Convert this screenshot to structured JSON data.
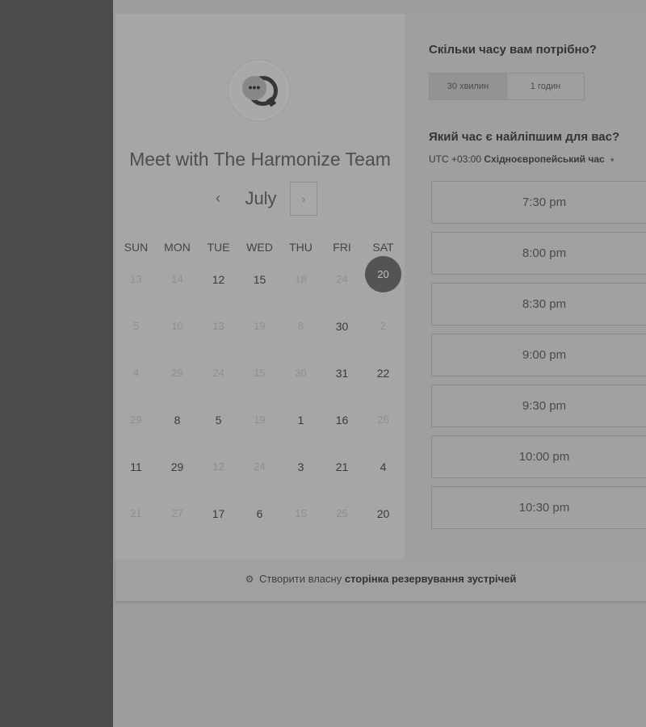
{
  "header": {
    "team_title": "Meet with The Harmonize Team"
  },
  "calendar": {
    "month": "July",
    "prev_icon": "‹",
    "next_icon": "›",
    "weekdays": [
      "SUN",
      "MON",
      "TUE",
      "WED",
      "THU",
      "FRI",
      "SAT"
    ],
    "weeks": [
      [
        {
          "d": "13",
          "s": "muted"
        },
        {
          "d": "14",
          "s": "muted"
        },
        {
          "d": "12",
          "s": "active"
        },
        {
          "d": "15",
          "s": "active"
        },
        {
          "d": "18",
          "s": "muted"
        },
        {
          "d": "24",
          "s": "muted"
        },
        {
          "d": "20",
          "s": "selected"
        }
      ],
      [
        {
          "d": "5",
          "s": "muted"
        },
        {
          "d": "10",
          "s": "muted"
        },
        {
          "d": "13",
          "s": "muted"
        },
        {
          "d": "19",
          "s": "muted"
        },
        {
          "d": "8",
          "s": "muted"
        },
        {
          "d": "30",
          "s": "active"
        },
        {
          "d": "2",
          "s": "muted"
        }
      ],
      [
        {
          "d": "4",
          "s": "muted"
        },
        {
          "d": "29",
          "s": "muted"
        },
        {
          "d": "24",
          "s": "muted"
        },
        {
          "d": "15",
          "s": "muted"
        },
        {
          "d": "30",
          "s": "muted"
        },
        {
          "d": "31",
          "s": "active"
        },
        {
          "d": "22",
          "s": "active"
        }
      ],
      [
        {
          "d": "29",
          "s": "muted"
        },
        {
          "d": "8",
          "s": "active"
        },
        {
          "d": "5",
          "s": "active"
        },
        {
          "d": "19",
          "s": "muted"
        },
        {
          "d": "1",
          "s": "active"
        },
        {
          "d": "16",
          "s": "active"
        },
        {
          "d": "26",
          "s": "muted"
        }
      ],
      [
        {
          "d": "11",
          "s": "active"
        },
        {
          "d": "29",
          "s": "active"
        },
        {
          "d": "12",
          "s": "muted"
        },
        {
          "d": "24",
          "s": "muted"
        },
        {
          "d": "3",
          "s": "active"
        },
        {
          "d": "21",
          "s": "active"
        },
        {
          "d": "4",
          "s": "active"
        }
      ],
      [
        {
          "d": "21",
          "s": "muted"
        },
        {
          "d": "27",
          "s": "muted"
        },
        {
          "d": "17",
          "s": "active"
        },
        {
          "d": "6",
          "s": "active"
        },
        {
          "d": "15",
          "s": "muted"
        },
        {
          "d": "25",
          "s": "muted"
        },
        {
          "d": "20",
          "s": "active"
        }
      ]
    ]
  },
  "duration": {
    "question": "Скільки часу вам потрібно?",
    "options": [
      "30 хвилин",
      "1 годин"
    ],
    "selected": "30 хвилин"
  },
  "timeslots": {
    "question": "Який час є найліпшим для вас?",
    "tz_offset": "UTC +03:00",
    "tz_name": "Східноєвропейський час",
    "tz_caret": "▾",
    "times": [
      "7:30 pm",
      "8:00 pm",
      "8:30 pm",
      "9:00 pm",
      "9:30 pm",
      "10:00 pm",
      "10:30 pm"
    ]
  },
  "footer": {
    "icon": "hubspot-sprocket-icon",
    "lead": "Створити власну",
    "bold": "сторінка резервування зустрічей"
  }
}
